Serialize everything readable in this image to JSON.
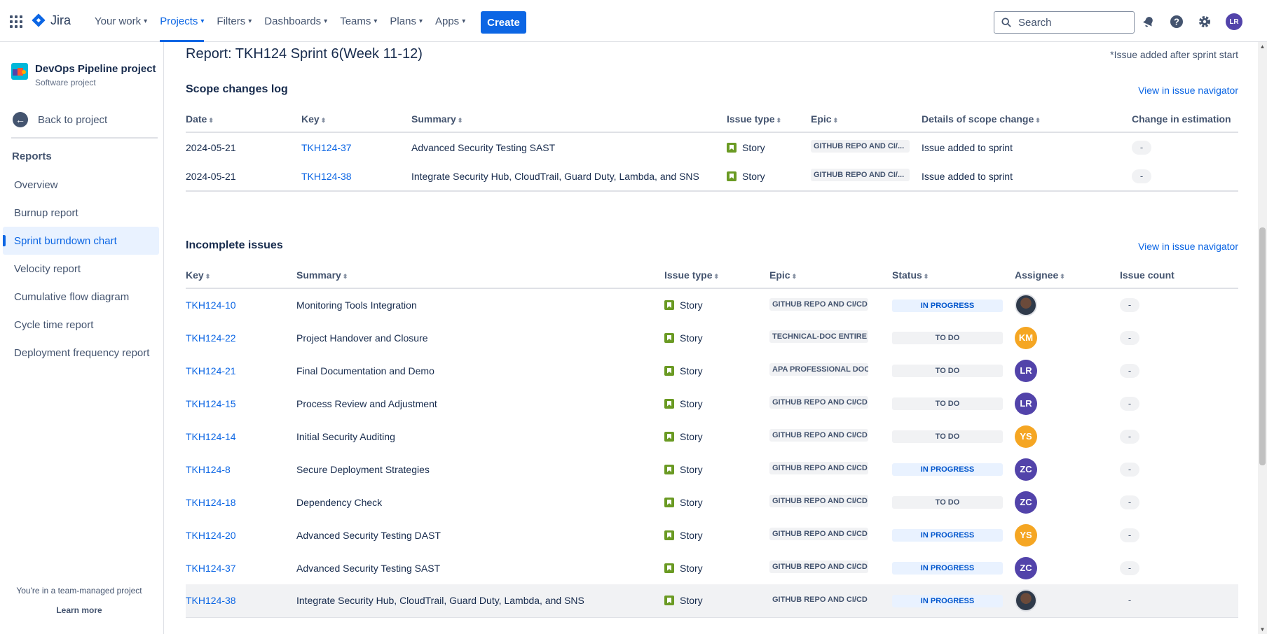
{
  "app": {
    "name": "Jira"
  },
  "nav": {
    "items": [
      {
        "label": "Your work",
        "active": false
      },
      {
        "label": "Projects",
        "active": true
      },
      {
        "label": "Filters",
        "active": false
      },
      {
        "label": "Dashboards",
        "active": false
      },
      {
        "label": "Teams",
        "active": false
      },
      {
        "label": "Plans",
        "active": false
      },
      {
        "label": "Apps",
        "active": false
      }
    ],
    "create_label": "Create",
    "search_placeholder": "Search",
    "user_initials": "LR"
  },
  "sidebar": {
    "project_name": "DevOps Pipeline project",
    "project_type": "Software project",
    "back_label": "Back to project",
    "reports_heading": "Reports",
    "items": [
      {
        "label": "Overview",
        "selected": false
      },
      {
        "label": "Burnup report",
        "selected": false
      },
      {
        "label": "Sprint burndown chart",
        "selected": true
      },
      {
        "label": "Velocity report",
        "selected": false
      },
      {
        "label": "Cumulative flow diagram",
        "selected": false
      },
      {
        "label": "Cycle time report",
        "selected": false
      },
      {
        "label": "Deployment frequency report",
        "selected": false
      }
    ],
    "team_note": "You're in a team-managed project",
    "learn_more": "Learn more"
  },
  "main": {
    "report_title": "Report: TKH124 Sprint 6(Week 11-12)",
    "note": "*Issue added after sprint start",
    "scope": {
      "title": "Scope changes log",
      "link": "View in issue navigator",
      "columns": [
        "Date",
        "Key",
        "Summary",
        "Issue type",
        "Epic",
        "Details of scope change",
        "Change in estimation"
      ],
      "rows": [
        {
          "date": "2024-05-21",
          "key": "TKH124-37",
          "summary": "Advanced Security Testing SAST",
          "type": "Story",
          "epic": "GITHUB REPO AND CI/...",
          "details": "Issue added to sprint",
          "change": "-"
        },
        {
          "date": "2024-05-21",
          "key": "TKH124-38",
          "summary": "Integrate Security Hub, CloudTrail, Guard Duty, Lambda, and SNS",
          "type": "Story",
          "epic": "GITHUB REPO AND CI/...",
          "details": "Issue added to sprint",
          "change": "-"
        }
      ]
    },
    "incomplete": {
      "title": "Incomplete issues",
      "link": "View in issue navigator",
      "columns": [
        "Key",
        "Summary",
        "Issue type",
        "Epic",
        "Status",
        "Assignee",
        "Issue count"
      ],
      "rows": [
        {
          "key": "TKH124-10",
          "summary": "Monitoring Tools Integration",
          "type": "Story",
          "epic": "GITHUB REPO AND CI/CD ...",
          "status": "IN PROGRESS",
          "assignee": "",
          "assignee_color": "photo",
          "count": "-"
        },
        {
          "key": "TKH124-22",
          "summary": "Project Handover and Closure",
          "type": "Story",
          "epic": "TECHNICAL-DOC ENTIRE P...",
          "status": "TO DO",
          "assignee": "KM",
          "assignee_color": "#f5a623",
          "count": "-"
        },
        {
          "key": "TKH124-21",
          "summary": "Final Documentation and Demo",
          "type": "Story",
          "epic": "APA PROFESSIONAL DOC-...",
          "status": "TO DO",
          "assignee": "LR",
          "assignee_color": "#5243aa",
          "count": "-"
        },
        {
          "key": "TKH124-15",
          "summary": "Process Review and Adjustment",
          "type": "Story",
          "epic": "GITHUB REPO AND CI/CD ...",
          "status": "TO DO",
          "assignee": "LR",
          "assignee_color": "#5243aa",
          "count": "-"
        },
        {
          "key": "TKH124-14",
          "summary": "Initial Security Auditing",
          "type": "Story",
          "epic": "GITHUB REPO AND CI/CD ...",
          "status": "TO DO",
          "assignee": "YS",
          "assignee_color": "#f5a623",
          "count": "-"
        },
        {
          "key": "TKH124-8",
          "summary": "Secure Deployment Strategies",
          "type": "Story",
          "epic": "GITHUB REPO AND CI/CD ...",
          "status": "IN PROGRESS",
          "assignee": "ZC",
          "assignee_color": "#5243aa",
          "count": "-"
        },
        {
          "key": "TKH124-18",
          "summary": "Dependency Check",
          "type": "Story",
          "epic": "GITHUB REPO AND CI/CD ...",
          "status": "TO DO",
          "assignee": "ZC",
          "assignee_color": "#5243aa",
          "count": "-"
        },
        {
          "key": "TKH124-20",
          "summary": "Advanced Security Testing DAST",
          "type": "Story",
          "epic": "GITHUB REPO AND CI/CD ...",
          "status": "IN PROGRESS",
          "assignee": "YS",
          "assignee_color": "#f5a623",
          "count": "-"
        },
        {
          "key": "TKH124-37",
          "summary": "Advanced Security Testing SAST",
          "type": "Story",
          "epic": "GITHUB REPO AND CI/CD ...",
          "status": "IN PROGRESS",
          "assignee": "ZC",
          "assignee_color": "#5243aa",
          "count": "-"
        },
        {
          "key": "TKH124-38",
          "summary": "Integrate Security Hub, CloudTrail, Guard Duty, Lambda, and SNS",
          "type": "Story",
          "epic": "GITHUB REPO AND CI/CD ...",
          "status": "IN PROGRESS",
          "assignee": "",
          "assignee_color": "photo",
          "count": "-"
        }
      ]
    }
  },
  "colors": {
    "accent": "#0c66e4",
    "story": "#6a9a23"
  }
}
